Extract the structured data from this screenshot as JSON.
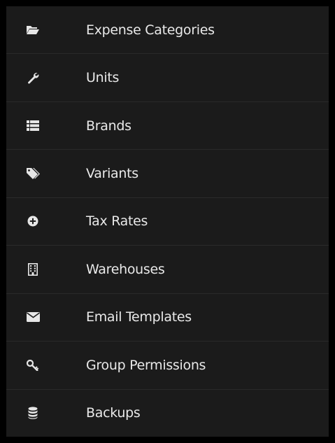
{
  "menu": {
    "items": [
      {
        "label": "Expense Categories",
        "icon": "folder-open-icon"
      },
      {
        "label": "Units",
        "icon": "wrench-icon"
      },
      {
        "label": "Brands",
        "icon": "table-list-icon"
      },
      {
        "label": "Variants",
        "icon": "tags-icon"
      },
      {
        "label": "Tax Rates",
        "icon": "plus-circle-icon"
      },
      {
        "label": "Warehouses",
        "icon": "building-icon"
      },
      {
        "label": "Email Templates",
        "icon": "envelope-icon"
      },
      {
        "label": "Group Permissions",
        "icon": "key-icon"
      },
      {
        "label": "Backups",
        "icon": "database-icon"
      }
    ],
    "colors": {
      "background": "#1b1b1b",
      "text": "#e9e9e9",
      "divider": "#2a2a2a",
      "frame": "#000000"
    }
  }
}
